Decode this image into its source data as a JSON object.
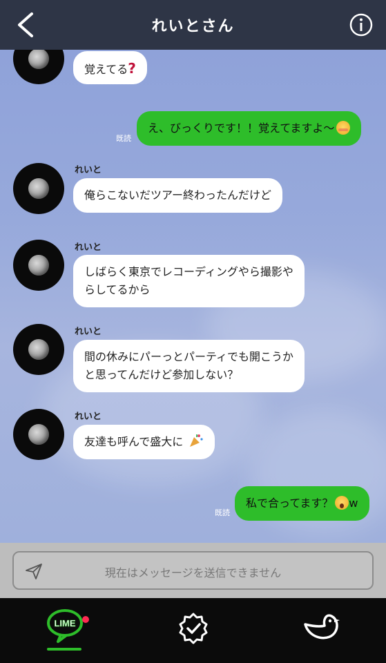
{
  "header": {
    "title": "れいとさん",
    "back_icon": "chevron-left-icon",
    "info_icon": "info-circle-icon"
  },
  "messages": [
    {
      "side": "in",
      "sender": "",
      "text": "覚えてる",
      "emoji": "red-question-mark"
    },
    {
      "side": "out",
      "read": "既読",
      "text": "え、びっくりです！！覚えてますよ〜",
      "emoji": "smiling-blush-face"
    },
    {
      "side": "in",
      "sender": "れいと",
      "text": "俺らこないだツアー終わったんだけど"
    },
    {
      "side": "in",
      "sender": "れいと",
      "line1": "しばらく東京でレコーディングやら撮影や",
      "line2": "らしてるから"
    },
    {
      "side": "in",
      "sender": "れいと",
      "line1": "間の休みにパーっとパーティでも開こうか",
      "line2": "と思ってんだけど参加しない？"
    },
    {
      "side": "in",
      "sender": "れいと",
      "text": "友達も呼んで盛大に",
      "emoji": "party-popper"
    },
    {
      "side": "out",
      "read": "既読",
      "text": "私で合ってます？",
      "emoji": "astonished-face",
      "suffix": "w"
    }
  ],
  "input": {
    "placeholder": "現在はメッセージを送信できません",
    "send_icon": "paper-plane-icon"
  },
  "nav": {
    "items": [
      "lime-chat-icon",
      "verified-badge-icon",
      "bird-icon"
    ],
    "lime_label": "LIME",
    "notification": true
  },
  "colors": {
    "header_bg": "#2e3546",
    "outgoing_bubble": "#2ebd2a",
    "incoming_bubble": "#ffffff",
    "nav_bg": "#0b0b0b",
    "notification_dot": "#ff2b52"
  }
}
